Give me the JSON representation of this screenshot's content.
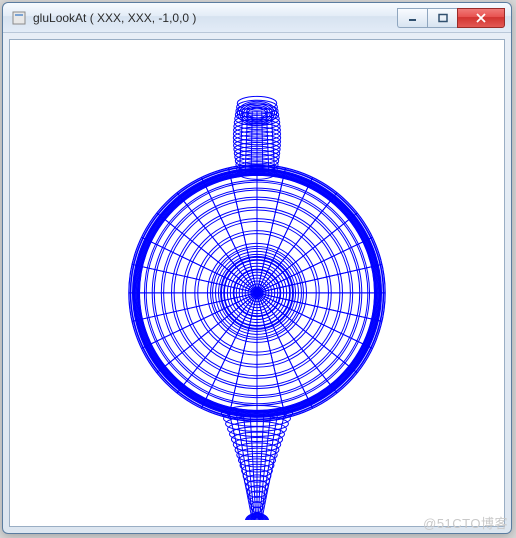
{
  "window": {
    "title": "gluLookAt ( XXX, XXX, -1,0,0 )",
    "icon_name": "app-icon"
  },
  "buttons": {
    "minimize_tip": "Minimize",
    "maximize_tip": "Maximize",
    "close_tip": "Close"
  },
  "watermark": "@51CTO博客",
  "render": {
    "description": "OpenGL wireframe teapot viewed from above (top-down along Y axis)",
    "stroke_color": "#0000ff",
    "background": "#ffffff",
    "object": "utah-teapot-wireframe",
    "view": "top"
  }
}
